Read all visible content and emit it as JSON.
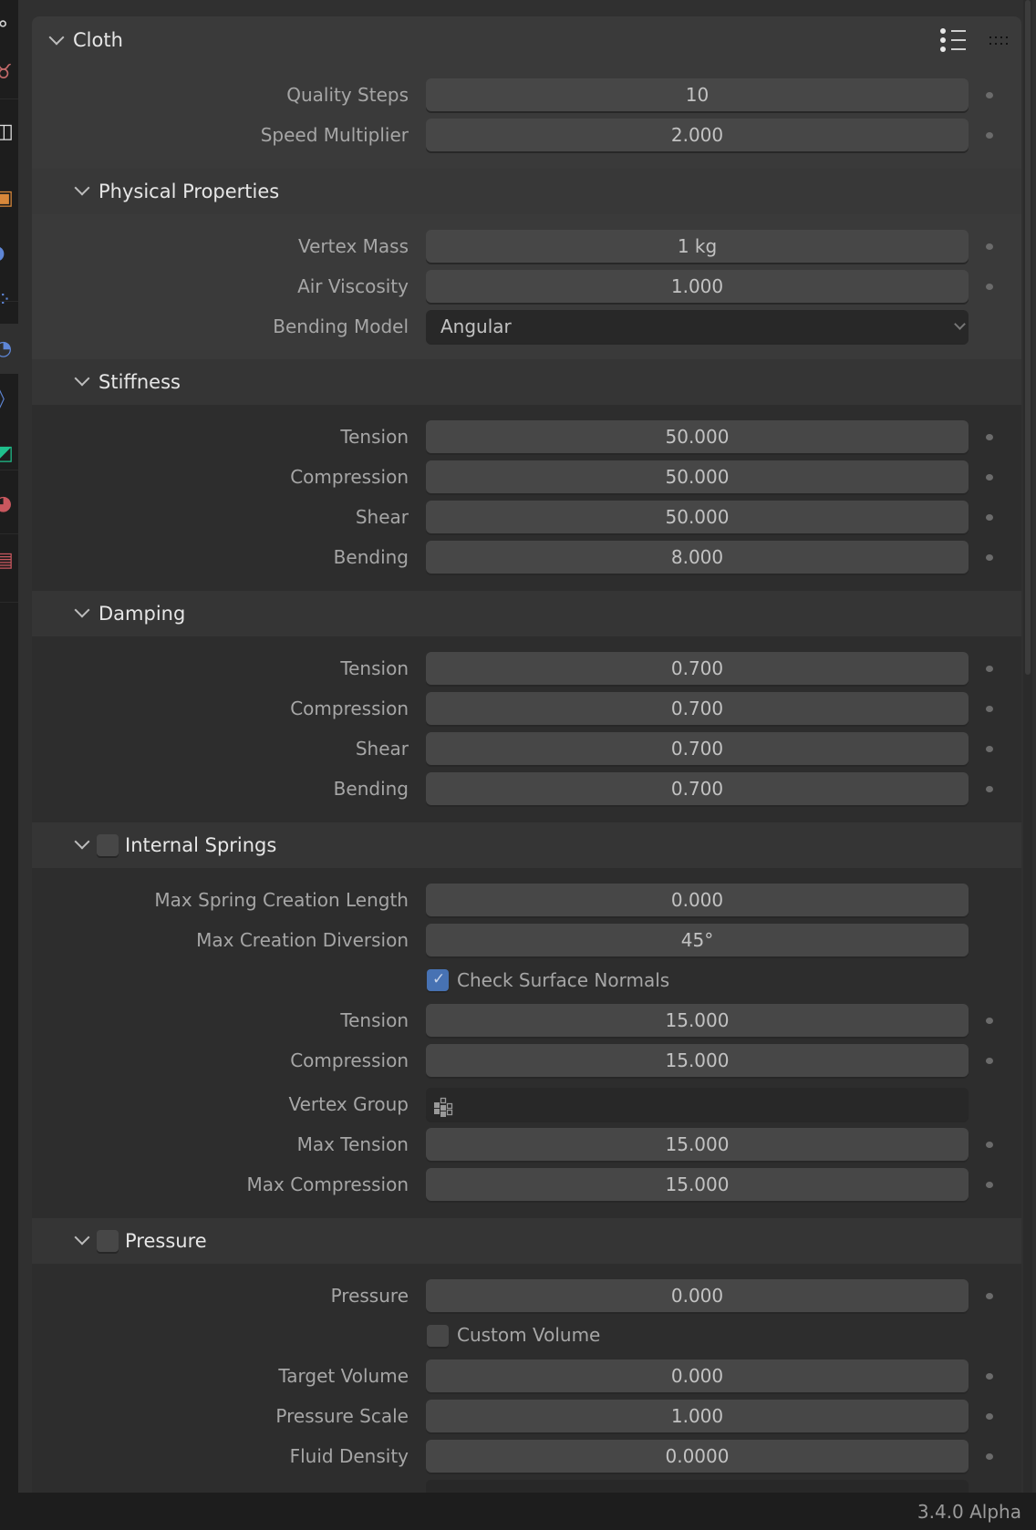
{
  "sidebar_tabs": [
    {
      "icon": "constraint-icon",
      "color": "#cfcfcf"
    },
    {
      "icon": "scene-icon",
      "color": "#c46a6a"
    },
    {
      "icon": "world-icon",
      "color": "#e0e0e0"
    },
    {
      "icon": "object-icon",
      "color": "#d9883a"
    },
    {
      "icon": "modifier-icon",
      "color": "#5e86d6"
    },
    {
      "icon": "particles-icon",
      "color": "#5e86d6"
    },
    {
      "icon": "physics-icon",
      "color": "#5e86d6",
      "active": true
    },
    {
      "icon": "object-constraint-icon",
      "color": "#5e86d6"
    },
    {
      "icon": "object-data-icon",
      "color": "#1fbf8c"
    },
    {
      "icon": "material-icon",
      "color": "#c9575e"
    },
    {
      "icon": "texture-icon",
      "color": "#c9575e"
    }
  ],
  "panel": {
    "title": "Cloth",
    "rows": [
      {
        "label": "Quality Steps",
        "value": "10"
      },
      {
        "label": "Speed Multiplier",
        "value": "2.000"
      }
    ]
  },
  "physical": {
    "title": "Physical Properties",
    "rows": [
      {
        "label": "Vertex Mass",
        "value": "1 kg"
      },
      {
        "label": "Air Viscosity",
        "value": "1.000"
      }
    ],
    "bending_model": {
      "label": "Bending Model",
      "value": "Angular"
    }
  },
  "stiffness": {
    "title": "Stiffness",
    "rows": [
      {
        "label": "Tension",
        "value": "50.000"
      },
      {
        "label": "Compression",
        "value": "50.000"
      },
      {
        "label": "Shear",
        "value": "50.000"
      },
      {
        "label": "Bending",
        "value": "8.000"
      }
    ]
  },
  "damping": {
    "title": "Damping",
    "rows": [
      {
        "label": "Tension",
        "value": "0.700"
      },
      {
        "label": "Compression",
        "value": "0.700"
      },
      {
        "label": "Shear",
        "value": "0.700"
      },
      {
        "label": "Bending",
        "value": "0.700"
      }
    ]
  },
  "internal_springs": {
    "title": "Internal Springs",
    "enabled": false,
    "rows": [
      {
        "label": "Max Spring Creation Length",
        "value": "0.000"
      },
      {
        "label": "Max Creation Diversion",
        "value": "45°"
      }
    ],
    "check_surface_normals": {
      "label": "Check Surface Normals",
      "checked": true
    },
    "rows2": [
      {
        "label": "Tension",
        "value": "15.000"
      },
      {
        "label": "Compression",
        "value": "15.000"
      }
    ],
    "vertex_group": {
      "label": "Vertex Group",
      "value": ""
    },
    "rows3": [
      {
        "label": "Max Tension",
        "value": "15.000"
      },
      {
        "label": "Max Compression",
        "value": "15.000"
      }
    ]
  },
  "pressure": {
    "title": "Pressure",
    "enabled": false,
    "rows": [
      {
        "label": "Pressure",
        "value": "0.000"
      }
    ],
    "custom_volume": {
      "label": "Custom Volume",
      "checked": false
    },
    "rows2": [
      {
        "label": "Target Volume",
        "value": "0.000"
      },
      {
        "label": "Pressure Scale",
        "value": "1.000"
      },
      {
        "label": "Fluid Density",
        "value": "0.0000"
      }
    ]
  },
  "status": {
    "version": "3.4.0 Alpha"
  }
}
